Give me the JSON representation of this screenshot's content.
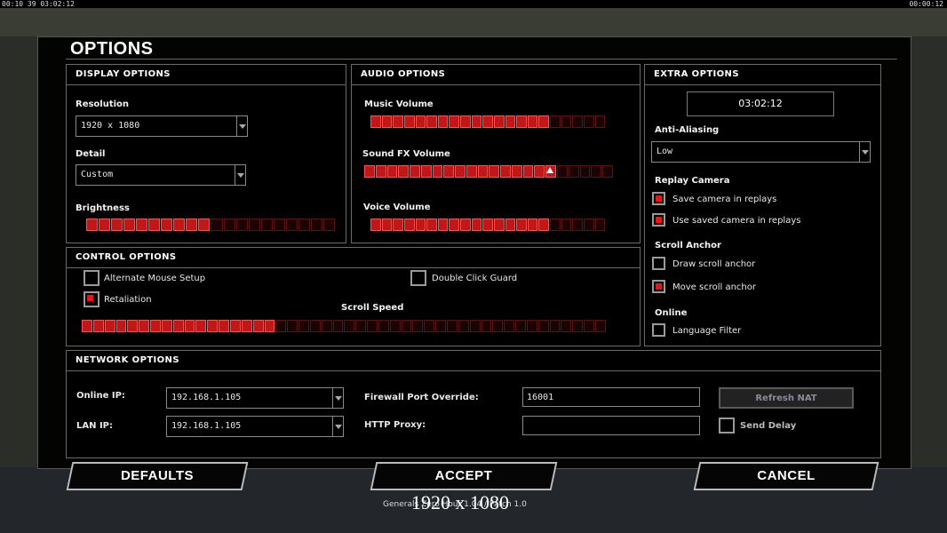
{
  "topbar": {
    "left_stats": "00:10 39 03:02:12",
    "right_time": "00:00:12"
  },
  "title": "OPTIONS",
  "display": {
    "header": "DISPLAY OPTIONS",
    "resolution_label": "Resolution",
    "resolution_value": "1920 x 1080",
    "detail_label": "Detail",
    "detail_value": "Custom",
    "brightness_label": "Brightness",
    "brightness_level": 0.5
  },
  "audio": {
    "header": "AUDIO OPTIONS",
    "music_label": "Music Volume",
    "music_level": 0.76,
    "sfx_label": "Sound FX Volume",
    "sfx_level": 0.76,
    "voice_label": "Voice Volume",
    "voice_level": 0.76
  },
  "extra": {
    "header": "EXTRA OPTIONS",
    "clock": "03:02:12",
    "aa_label": "Anti-Aliasing",
    "aa_value": "Low",
    "replay_label": "Replay Camera",
    "save_camera": "Save camera in replays",
    "use_saved_camera": "Use saved camera in replays",
    "scroll_anchor_label": "Scroll Anchor",
    "draw_scroll_anchor": "Draw scroll anchor",
    "move_scroll_anchor": "Move scroll anchor",
    "online_label": "Online",
    "language_filter": "Language Filter"
  },
  "control": {
    "header": "CONTROL OPTIONS",
    "alt_mouse": "Alternate Mouse Setup",
    "double_click": "Double Click Guard",
    "retaliation": "Retaliation",
    "scroll_speed_label": "Scroll Speed",
    "scroll_speed_level": 0.37
  },
  "network": {
    "header": "NETWORK OPTIONS",
    "online_ip_label": "Online IP:",
    "online_ip": "192.168.1.105",
    "lan_ip_label": "LAN IP:",
    "lan_ip": "192.168.1.105",
    "firewall_label": "Firewall Port Override:",
    "firewall_value": "16001",
    "proxy_label": "HTTP Proxy:",
    "proxy_value": "",
    "refresh_nat": "Refresh NAT",
    "send_delay": "Send Delay"
  },
  "buttons": {
    "defaults": "DEFAULTS",
    "accept": "ACCEPT",
    "cancel": "CANCEL"
  },
  "footer": "Generals Zero Hour 1.04 / Patch 1.0",
  "overlay": "1920 x 1080",
  "colors": {
    "slider_on": "#c01818",
    "slider_off": "#1a0303",
    "check_on": "#e01818"
  }
}
